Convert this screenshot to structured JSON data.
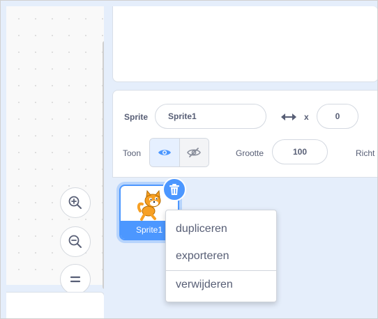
{
  "sprite_info": {
    "sprite_label": "Sprite",
    "sprite_name_value": "Sprite1",
    "x_label": "x",
    "x_value": "0",
    "show_label": "Toon",
    "size_label": "Grootte",
    "size_value": "100",
    "direction_label_partial": "Richt"
  },
  "sprite_list": {
    "sprites": [
      {
        "name": "Sprite1"
      }
    ]
  },
  "context_menu": {
    "items": [
      {
        "label": "dupliceren"
      },
      {
        "label": "exporteren"
      },
      {
        "label": "verwijderen"
      }
    ]
  },
  "code_area": {
    "zoom_in_icon": "zoom-in-icon",
    "zoom_out_icon": "zoom-out-icon",
    "zoom_reset_icon": "zoom-reset-icon"
  },
  "colors": {
    "accent": "#4c97ff",
    "text": "#575e75",
    "panel_bg": "#e5eefb"
  }
}
